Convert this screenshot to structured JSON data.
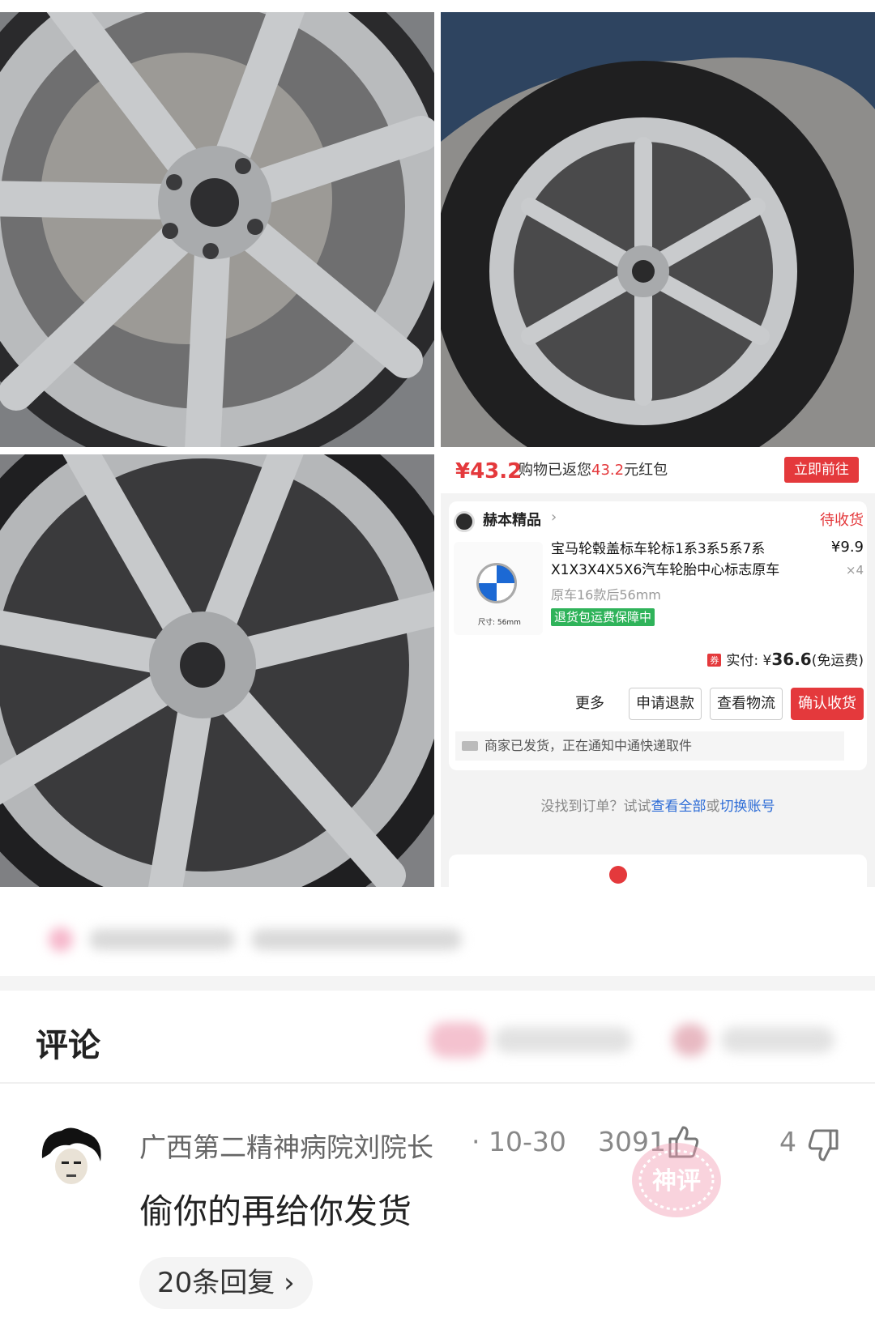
{
  "order": {
    "redpacket_amount": "¥43.2",
    "redpacket_prefix": "购物已返您",
    "redpacket_value": "43.2",
    "redpacket_suffix": "元红包",
    "go_button": "立即前往",
    "shop_name": "赫本精品",
    "shop_chevron": "›",
    "status": "待收货",
    "product_name": "宝马轮毂盖标车轮标1系3系5系7系X1X3X4X5X6汽车轮胎中心标志原车",
    "price": "¥9.9",
    "quantity": "×4",
    "spec": "原车16款后56mm",
    "size_label": "尺寸: 56mm",
    "guarantee": "退货包运费保障中",
    "coupon_tag": "券",
    "paid_label": "实付: ¥",
    "paid_amount": "36.6",
    "paid_note": "(免运费)",
    "more_label": "更多",
    "refund_button": "申请退款",
    "logistics_button": "查看物流",
    "confirm_button": "确认收货",
    "shipping_status": "商家已发货，正在通知中通快递取件",
    "notfound_prefix": "没找到订单？试试",
    "notfound_link1": "查看全部",
    "notfound_mid": "或",
    "notfound_link2": "切换账号"
  },
  "comments": {
    "title": "评论",
    "items": [
      {
        "username": "广西第二精神病院刘院长",
        "separator": "·",
        "time": "10-30",
        "likes": "3091",
        "dislikes": "4",
        "text": "偷你的再给你发货",
        "replies_label": "20条回复",
        "replies_chevron": "›",
        "badge": "神评"
      }
    ]
  },
  "icons": {
    "like": "thumbs-up-icon",
    "dislike": "thumbs-down-icon"
  },
  "colors": {
    "accent_red": "#e4393c",
    "guarantee_green": "#2fb35a",
    "link_blue": "#2b6bd6"
  }
}
